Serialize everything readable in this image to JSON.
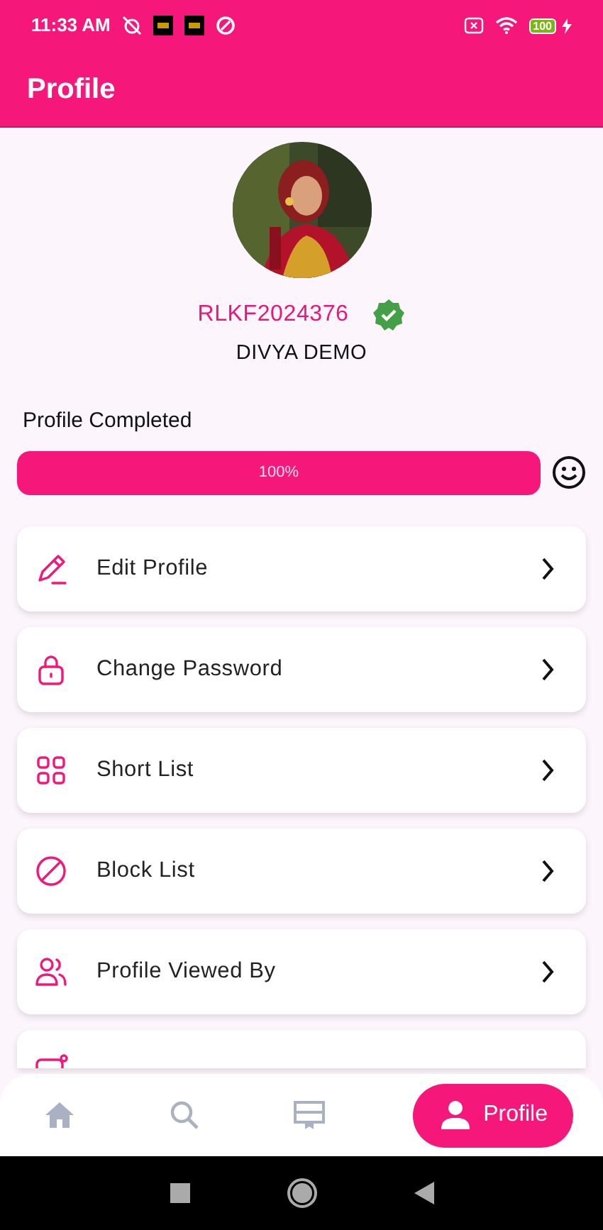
{
  "status_bar": {
    "time": "11:33 AM",
    "battery": "100"
  },
  "app_bar": {
    "title": "Profile"
  },
  "profile": {
    "id": "RLKF2024376",
    "verified": true,
    "name": "DIVYA DEMO"
  },
  "completion": {
    "label": "Profile Completed",
    "level": 1.0,
    "reading": "100%"
  },
  "menu": [
    {
      "label": "Edit Profile"
    },
    {
      "label": "Change Password"
    },
    {
      "label": "Short List"
    },
    {
      "label": "Block List"
    },
    {
      "label": "Profile Viewed By"
    },
    {
      "kind": "peek"
    }
  ],
  "bottom_nav": [
    {
      "selected": false
    },
    {
      "selected": false
    },
    {
      "selected": false
    },
    {
      "label": "Profile",
      "selected": true
    }
  ]
}
